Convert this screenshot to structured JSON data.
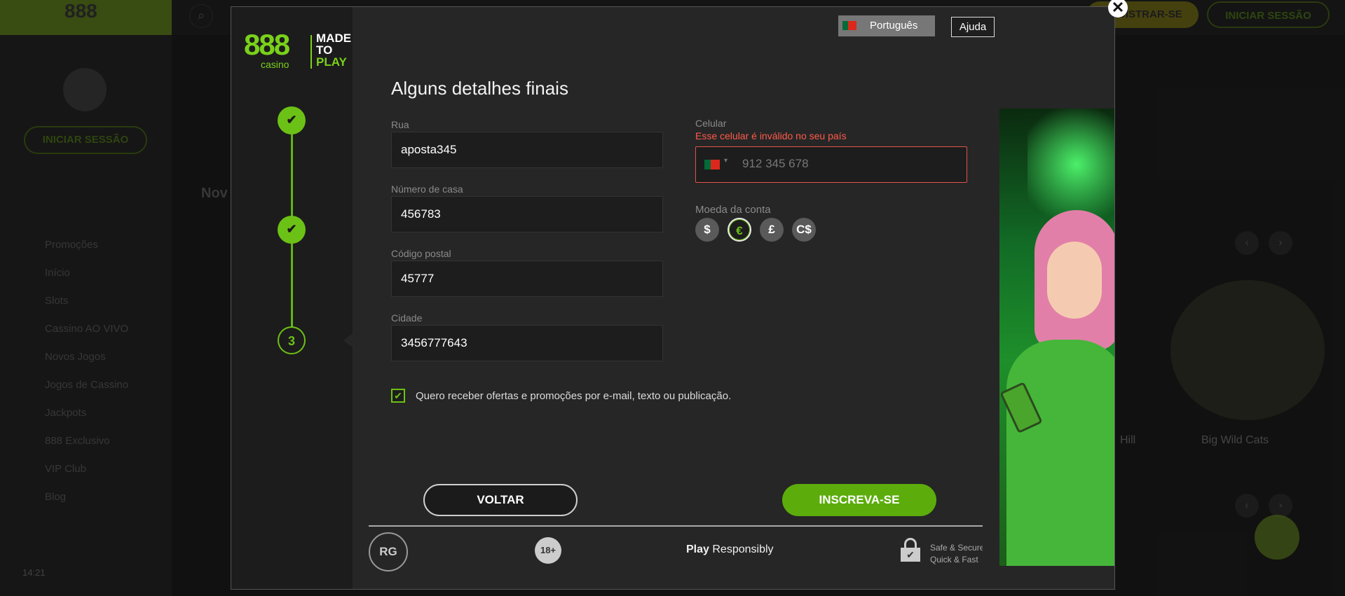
{
  "background": {
    "logo_text": "888",
    "register_label": "REGISTRAR-SE",
    "login_label": "INICIAR SESSÃO",
    "sidebar_login_label": "INICIAR SESSÃO",
    "section_title": "Nov",
    "menu": [
      "Promoções",
      "Início",
      "Slots",
      "Cassino AO VIVO",
      "Novos Jogos",
      "Jogos de Cassino",
      "Jackpots",
      "888 Exclusivo",
      "VIP Club",
      "Blog"
    ],
    "clock": "14:21",
    "game_title": "Big Wild Cats",
    "game_title_partial": "Hill"
  },
  "modal": {
    "close_symbol": "✕",
    "brand": {
      "logo": "888",
      "sub": "casino",
      "tagline_1": "MADE",
      "tagline_2": "TO",
      "tagline_3": "PLAY"
    },
    "language": "Português",
    "help_label": "Ajuda",
    "title": "Alguns detalhes finais",
    "steps": [
      {
        "state": "done",
        "symbol": "✔"
      },
      {
        "state": "done",
        "symbol": "✔"
      },
      {
        "state": "current",
        "symbol": "3"
      }
    ],
    "fields": {
      "street": {
        "label": "Rua",
        "value": "aposta345"
      },
      "house_number": {
        "label": "Número de casa",
        "value": "456783"
      },
      "postal_code": {
        "label": "Código postal",
        "value": "45777"
      },
      "city": {
        "label": "Cidade",
        "value": "3456777643"
      }
    },
    "phone": {
      "label": "Celular",
      "error": "Esse celular é inválido no seu país",
      "placeholder": "912 345 678",
      "country_caret": "▾"
    },
    "currency": {
      "label": "Moeda da conta",
      "options": [
        "$",
        "€",
        "£",
        "C$"
      ],
      "selected": "€"
    },
    "consent": {
      "checked_symbol": "✔",
      "label": "Quero receber ofertas e promoções por e-mail, texto ou publicação."
    },
    "buttons": {
      "back": "VOLTAR",
      "submit": "INSCREVA-SE"
    },
    "footer": {
      "rg_badge": "RG",
      "age_badge": "18+",
      "play_bold": "Play",
      "play_rest": " Responsibly",
      "secure_line1": "Safe & Secure",
      "secure_line2": "Quick & Fast"
    }
  },
  "colors": {
    "accent": "#6cc116",
    "error": "#ff5a4a",
    "submit": "#5cad0c"
  }
}
